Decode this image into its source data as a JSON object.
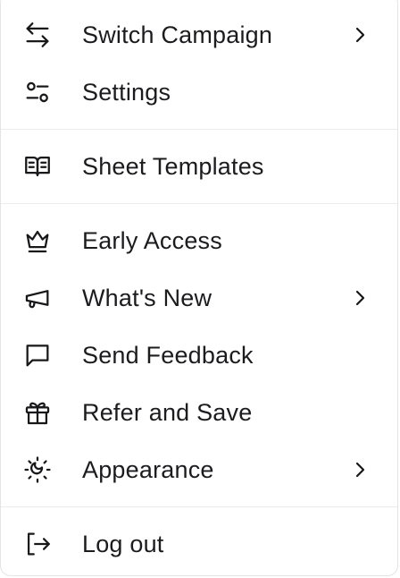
{
  "menu": {
    "items": [
      {
        "label": "Switch Campaign",
        "icon": "switch-arrows-icon",
        "has_submenu": true
      },
      {
        "label": "Settings",
        "icon": "sliders-icon",
        "has_submenu": false
      },
      {
        "label": "Sheet Templates",
        "icon": "open-book-icon",
        "has_submenu": false
      },
      {
        "label": "Early Access",
        "icon": "crown-icon",
        "has_submenu": false
      },
      {
        "label": "What's New",
        "icon": "megaphone-icon",
        "has_submenu": true
      },
      {
        "label": "Send Feedback",
        "icon": "message-square-icon",
        "has_submenu": false
      },
      {
        "label": "Refer and Save",
        "icon": "gift-icon",
        "has_submenu": false
      },
      {
        "label": "Appearance",
        "icon": "sun-moon-icon",
        "has_submenu": true
      },
      {
        "label": "Log out",
        "icon": "log-out-icon",
        "has_submenu": false
      }
    ]
  },
  "colors": {
    "text": "#1c1c1f",
    "icon": "#18181b",
    "divider": "#ececef",
    "border": "#e4e4e7",
    "background": "#ffffff"
  }
}
